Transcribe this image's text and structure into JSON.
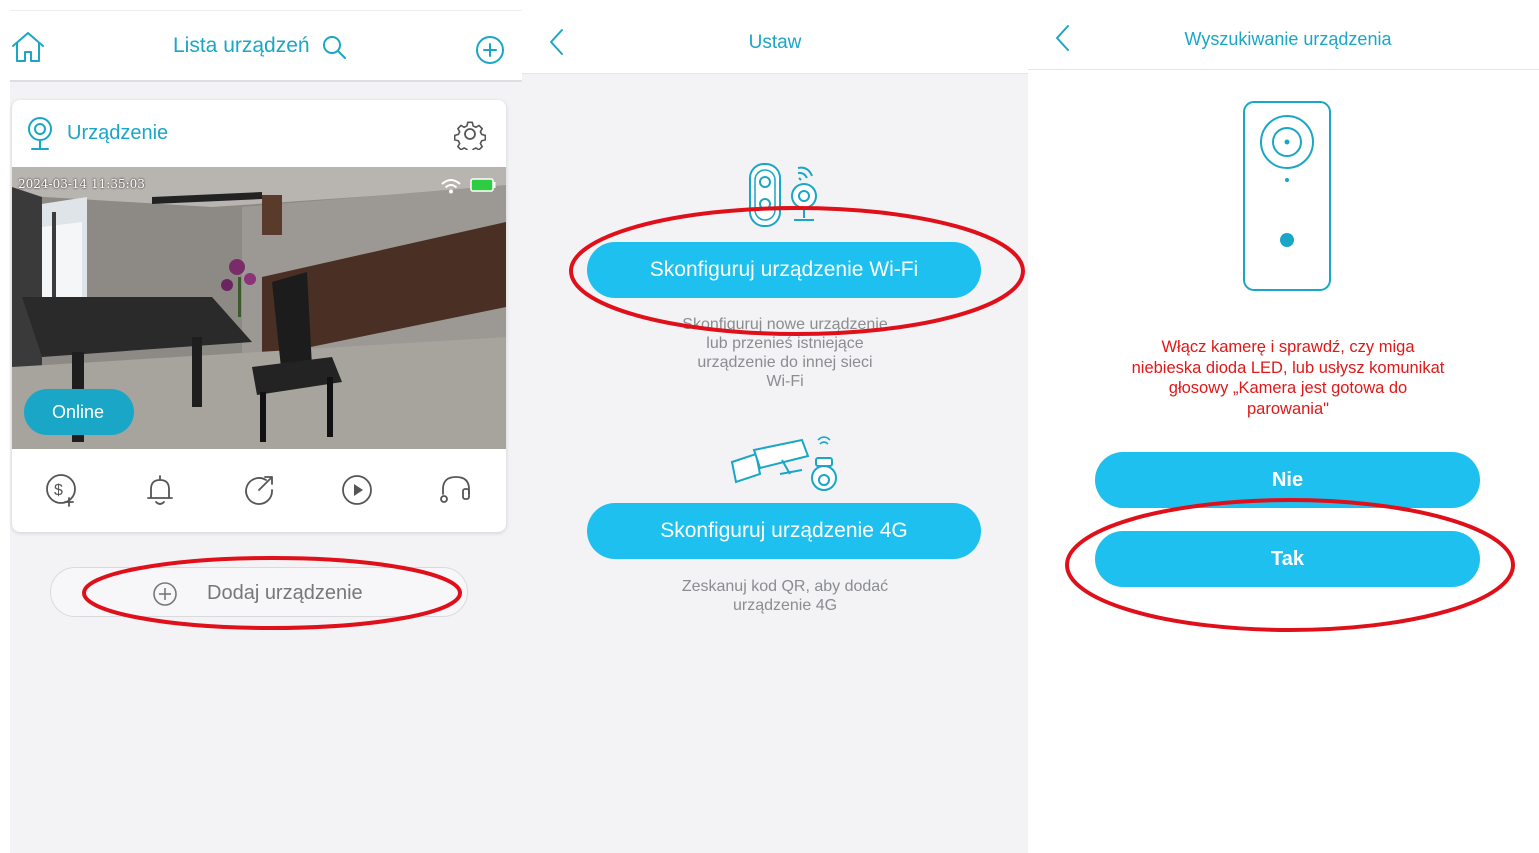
{
  "panel1": {
    "header": {
      "title": "Lista urządzeń"
    },
    "device_card": {
      "name": "Urządzenie",
      "timestamp": "2024-03-14 11:35:03",
      "status": "Online"
    },
    "add_device_label": "Dodaj urządzenie"
  },
  "panel2": {
    "header": {
      "title": "Ustaw"
    },
    "wifi_option": {
      "button_label": "Skonfiguruj urządzenie Wi-Fi",
      "description_lines": [
        "Skonfiguruj nowe urządzenie",
        "lub przenieś istniejące",
        "urządzenie do innej sieci",
        "Wi-Fi"
      ]
    },
    "lte_option": {
      "button_label": "Skonfiguruj urządzenie 4G",
      "description_lines": [
        "Zeskanuj kod QR, aby dodać",
        "urządzenie 4G"
      ]
    }
  },
  "panel3": {
    "header": {
      "title": "Wyszukiwanie urządzenia"
    },
    "instruction_lines": [
      "Włącz kamerę i sprawdź, czy miga",
      "niebieska dioda LED, lub usłysz komunikat",
      "głosowy „Kamera jest gotowa do",
      "parowania\""
    ],
    "no_label": "Nie",
    "yes_label": "Tak"
  },
  "colors": {
    "accent": "#1aa6c7",
    "button": "#1ec0ef",
    "annotation": "#e0101a",
    "warning_text": "#e01818"
  },
  "icons": [
    "home-icon",
    "search-icon",
    "add-circle-icon",
    "webcam-icon",
    "gear-icon",
    "wifi-icon",
    "battery-icon",
    "dollar-plus-icon",
    "bell-icon",
    "share-icon",
    "play-icon",
    "headset-icon",
    "plus-circle-icon",
    "chevron-left-icon",
    "doorbell-camera-icon",
    "cctv-camera-icon"
  ]
}
